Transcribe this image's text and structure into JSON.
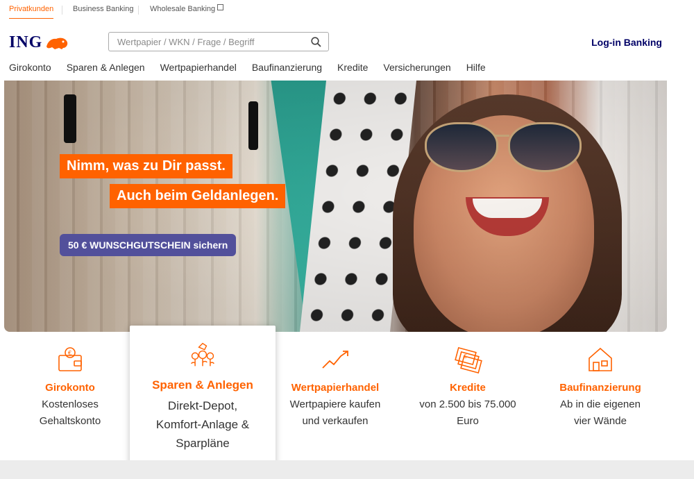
{
  "segments": [
    {
      "label": "Privatkunden",
      "active": true
    },
    {
      "label": "Business Banking",
      "active": false
    },
    {
      "label": "Wholesale Banking",
      "active": false,
      "external": true
    }
  ],
  "brand": {
    "logo_text": "ING",
    "accent": "#ff6200",
    "navy": "#000066",
    "cta_color": "#52509b"
  },
  "search": {
    "placeholder": "Wertpapier / WKN / Frage / Begriff",
    "value": ""
  },
  "login": {
    "label": "Log-in Banking"
  },
  "nav": [
    "Girokonto",
    "Sparen & Anlegen",
    "Wertpapierhandel",
    "Baufinanzierung",
    "Kredite",
    "Versicherungen",
    "Hilfe"
  ],
  "hero": {
    "headline_1": "Nimm, was zu Dir passt.",
    "headline_2": "Auch beim Geldanlegen.",
    "cta": "50 € WUNSCHGUTSCHEIN sichern"
  },
  "products": [
    {
      "title": "Girokonto",
      "desc": "Kostenloses Gehaltskonto",
      "icon": "wallet-euro-icon"
    },
    {
      "title": "Sparen & Anlegen",
      "desc": "Direkt-Depot, Komfort-Anlage & Sparpläne",
      "icon": "savings-plant-icon"
    },
    {
      "title": "Wertpapierhandel",
      "desc": "Wertpapiere kaufen und verkaufen",
      "icon": "chart-trend-icon"
    },
    {
      "title": "Kredite",
      "desc": "von 2.500 bis 75.000 Euro",
      "icon": "banknotes-euro-icon"
    },
    {
      "title": "Baufinanzierung",
      "desc": "Ab in die eigenen vier Wände",
      "icon": "house-icon"
    }
  ]
}
